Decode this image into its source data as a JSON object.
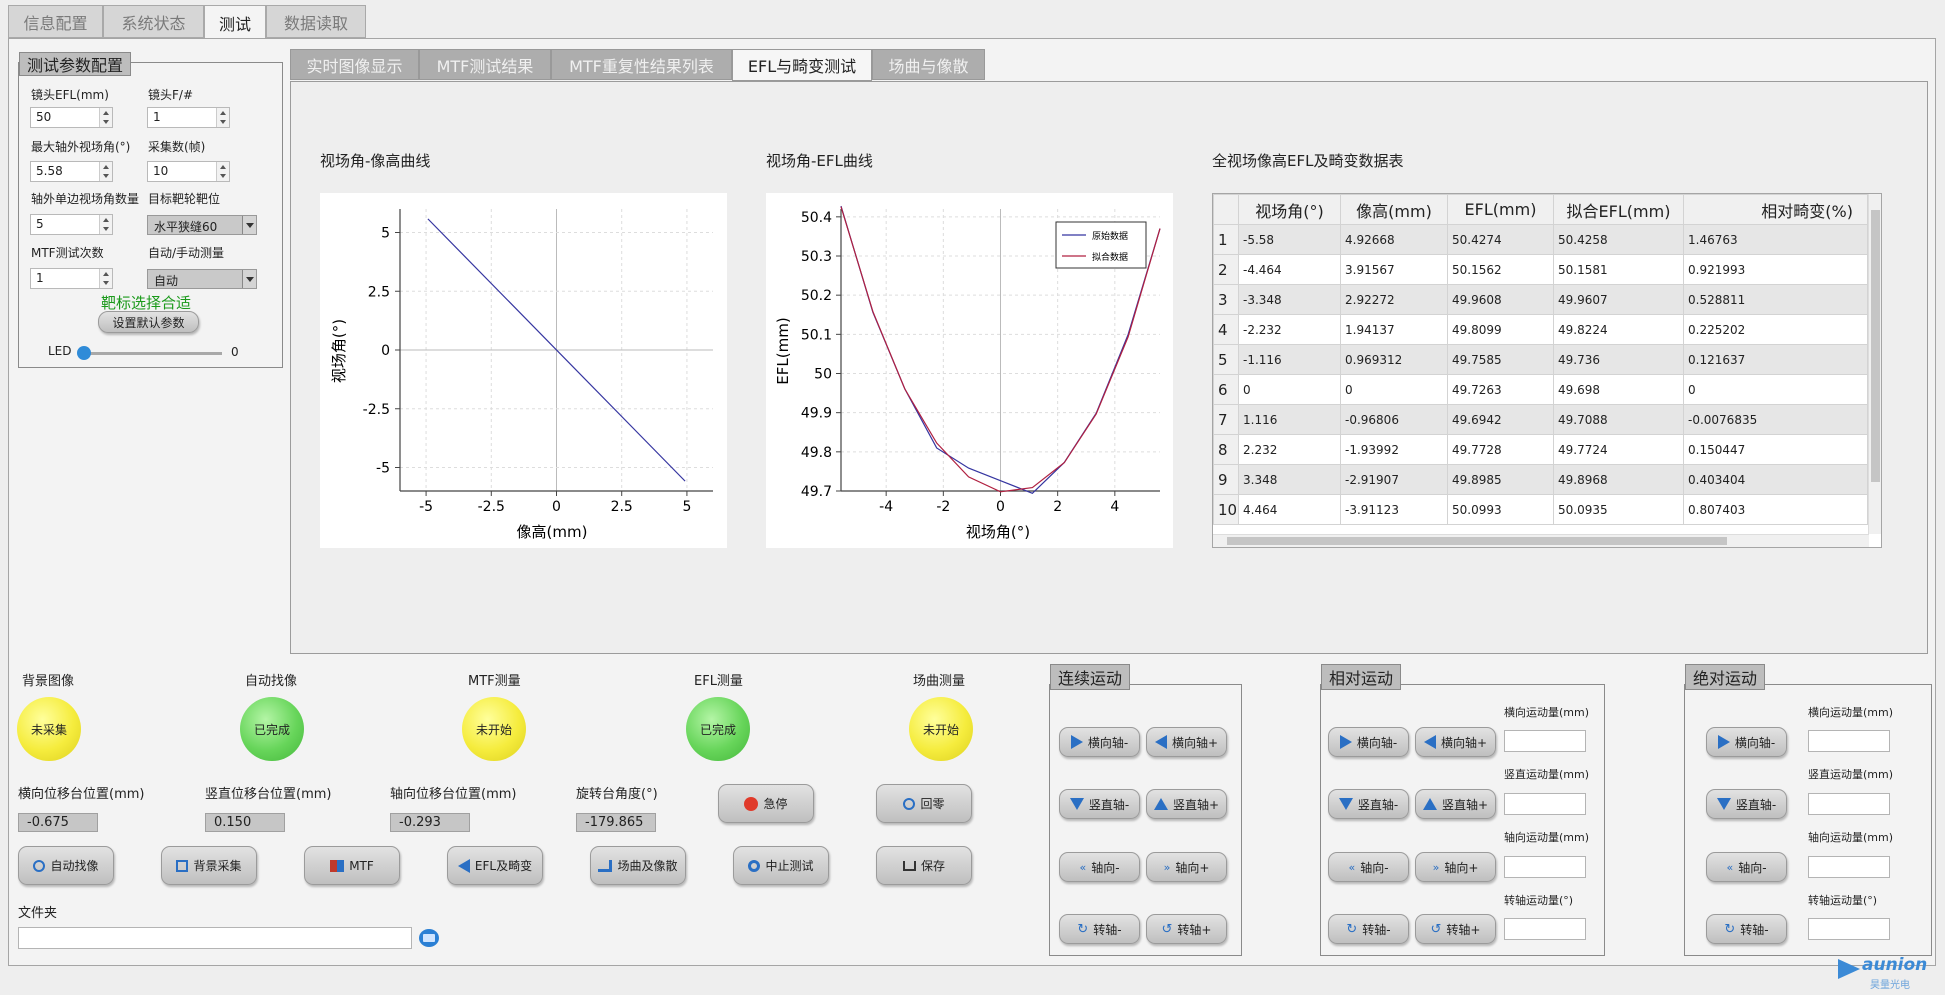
{
  "tabs": [
    "信息配置",
    "系统状态",
    "测试",
    "数据读取"
  ],
  "subtabs": [
    "实时图像显示",
    "MTF测试结果",
    "MTF重复性结果列表",
    "EFL与畸变测试",
    "场曲与像散"
  ],
  "config": {
    "title": "测试参数配置",
    "efl_label": "镜头EFL(mm)",
    "efl_value": "50",
    "fno_label": "镜头F/#",
    "fno_value": "1",
    "fov_label": "最大轴外视场角(°)",
    "fov_value": "5.58",
    "frames_label": "采集数(帧)",
    "frames_value": "10",
    "count_label": "轴外单边视场角数量",
    "count_value": "5",
    "target_label": "目标靶轮靶位",
    "target_value": "水平狭缝60",
    "mtf_times_label": "MTF测试次数",
    "mtf_times_value": "1",
    "mode_label": "自动/手动测量",
    "mode_value": "自动",
    "status": "靶标选择合适",
    "default_btn": "设置默认参数",
    "led_label": "LED",
    "led_value": "0",
    "led_level": 0
  },
  "charts": {
    "c1_title": "视场角-像高曲线",
    "c2_title": "视场角-EFL曲线",
    "table_title": "全视场像高EFL及畸变数据表"
  },
  "chart_data": [
    {
      "type": "line",
      "xlabel": "像高(mm)",
      "ylabel": "视场角(°)",
      "xlim": [
        -6,
        6
      ],
      "ylim": [
        -6,
        6
      ],
      "xticks": [
        "-5",
        "-2.5",
        "0",
        "2.5",
        "5"
      ],
      "yticks": [
        "5",
        "2.5",
        "0",
        "-2.5",
        "-5"
      ],
      "series": [
        {
          "color": "#3535a0",
          "x": [
            -4.93,
            4.93
          ],
          "y": [
            5.58,
            -5.58
          ]
        }
      ]
    },
    {
      "type": "line",
      "xlabel": "视场角(°)",
      "ylabel": "EFL(mm)",
      "xlim": [
        -5.58,
        5.58
      ],
      "ylim": [
        49.7,
        50.42
      ],
      "xticks": [
        "-4",
        "-2",
        "0",
        "2",
        "4"
      ],
      "yticks": [
        "50.4",
        "50.3",
        "50.2",
        "50.1",
        "50",
        "49.9",
        "49.8",
        "49.7"
      ],
      "legend": [
        "原始数据",
        "拟合数据"
      ],
      "legend_colors": [
        "#3535a0",
        "#b02040"
      ],
      "x": [
        -5.58,
        -4.464,
        -3.348,
        -2.232,
        -1.116,
        0,
        1.116,
        2.232,
        3.348,
        4.464,
        5.58
      ],
      "series": [
        {
          "name": "原始数据",
          "values": [
            50.4274,
            50.1562,
            49.9608,
            49.8099,
            49.7585,
            49.7263,
            49.6942,
            49.7728,
            49.8985,
            50.0993,
            50.37
          ]
        },
        {
          "name": "拟合数据",
          "values": [
            50.4258,
            50.1581,
            49.9607,
            49.8224,
            49.736,
            49.698,
            49.7088,
            49.7724,
            49.8968,
            50.0935,
            50.37
          ]
        }
      ]
    }
  ],
  "table": {
    "headers": [
      "视场角(°)",
      "像高(mm)",
      "EFL(mm)",
      "拟合EFL(mm)",
      "相对畸变(%)"
    ],
    "rows": [
      [
        "1",
        "-5.58",
        "4.92668",
        "50.4274",
        "50.4258",
        "1.46763"
      ],
      [
        "2",
        "-4.464",
        "3.91567",
        "50.1562",
        "50.1581",
        "0.921993"
      ],
      [
        "3",
        "-3.348",
        "2.92272",
        "49.9608",
        "49.9607",
        "0.528811"
      ],
      [
        "4",
        "-2.232",
        "1.94137",
        "49.8099",
        "49.8224",
        "0.225202"
      ],
      [
        "5",
        "-1.116",
        "0.969312",
        "49.7585",
        "49.736",
        "0.121637"
      ],
      [
        "6",
        "0",
        "0",
        "49.7263",
        "49.698",
        "0"
      ],
      [
        "7",
        "1.116",
        "-0.96806",
        "49.6942",
        "49.7088",
        "-0.0076835"
      ],
      [
        "8",
        "2.232",
        "-1.93992",
        "49.7728",
        "49.7724",
        "0.150447"
      ],
      [
        "9",
        "3.348",
        "-2.91907",
        "49.8985",
        "49.8968",
        "0.403404"
      ],
      [
        "10",
        "4.464",
        "-3.91123",
        "50.0993",
        "50.0935",
        "0.807403"
      ]
    ]
  },
  "status": {
    "bg_label": "背景图像",
    "bg_state": "未采集",
    "af_label": "自动找像",
    "af_state": "已完成",
    "mtf_label": "MTF测量",
    "mtf_state": "未开始",
    "efl_label": "EFL测量",
    "efl_state": "已完成",
    "fc_label": "场曲测量",
    "fc_state": "未开始"
  },
  "positions": {
    "x_label": "横向位移台位置(mm)",
    "x_value": "-0.675",
    "y_label": "竖直位移台位置(mm)",
    "y_value": "0.150",
    "z_label": "轴向位移台位置(mm)",
    "z_value": "-0.293",
    "r_label": "旋转台角度(°)",
    "r_value": "-179.865"
  },
  "actions": {
    "estop": "急停",
    "home": "回零",
    "autofocus": "自动找像",
    "bgcap": "背景采集",
    "mtf": "MTF",
    "efl": "EFL及畸变",
    "field": "场曲及像散",
    "stop": "中止测试",
    "save": "保存"
  },
  "folder": {
    "label": "文件夹",
    "value": ""
  },
  "motion": {
    "cont_title": "连续运动",
    "rel_title": "相对运动",
    "abs_title": "绝对运动",
    "xm": "横向轴-",
    "xp": "横向轴+",
    "ym": "竖直轴-",
    "yp": "竖直轴+",
    "zm": "轴向-",
    "zp": "轴向+",
    "rm": "转轴-",
    "rp": "转轴+",
    "x_amt": "横向运动量(mm)",
    "y_amt": "竖直运动量(mm)",
    "z_amt": "轴向运动量(mm)",
    "r_amt": "转轴运动量(°)"
  },
  "logo": {
    "name": "aunion",
    "sub": "昊量光电"
  }
}
